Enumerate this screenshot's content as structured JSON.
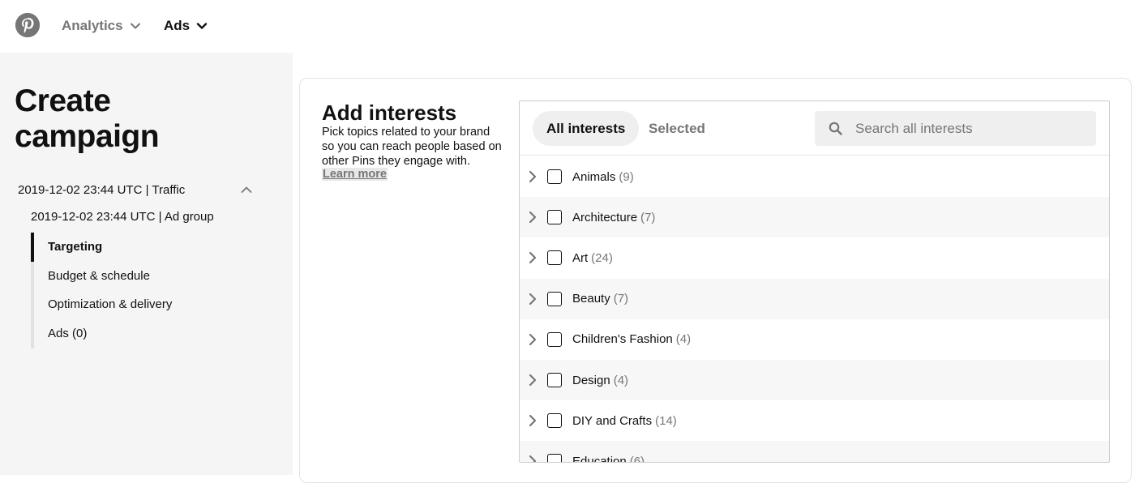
{
  "nav": {
    "logo_icon": "pinterest-logo",
    "items": [
      {
        "label": "Analytics",
        "icon": "chevron-down-icon"
      },
      {
        "label": "Ads",
        "icon": "chevron-down-icon"
      }
    ]
  },
  "sidebar": {
    "title": "Create campaign",
    "campaign": "2019-12-02 23:44 UTC | Traffic",
    "ad_group": "2019-12-02 23:44 UTC | Ad group",
    "steps": [
      {
        "label": "Targeting",
        "active": true
      },
      {
        "label": "Budget & schedule",
        "active": false
      },
      {
        "label": "Optimization & delivery",
        "active": false
      },
      {
        "label": "Ads (0)",
        "active": false
      }
    ]
  },
  "interests": {
    "title": "Add interests",
    "description": "Pick topics related to your brand so you can reach people based on other Pins they engage with.",
    "learn_more": "Learn more",
    "tabs": [
      {
        "label": "All interests",
        "active": true
      },
      {
        "label": "Selected",
        "active": false
      }
    ],
    "search_placeholder": "Search all interests",
    "items": [
      {
        "name": "Animals",
        "count": "(9)"
      },
      {
        "name": "Architecture",
        "count": "(7)"
      },
      {
        "name": "Art",
        "count": "(24)"
      },
      {
        "name": "Beauty",
        "count": "(7)"
      },
      {
        "name": "Children's Fashion",
        "count": "(4)"
      },
      {
        "name": "Design",
        "count": "(4)"
      },
      {
        "name": "DIY and Crafts",
        "count": "(14)"
      },
      {
        "name": "Education",
        "count": "(6)"
      }
    ]
  },
  "colors": {
    "text": "#111111",
    "muted": "#767676",
    "sidebar_bg": "#f5f5f5",
    "pill_bg": "#efefef"
  }
}
